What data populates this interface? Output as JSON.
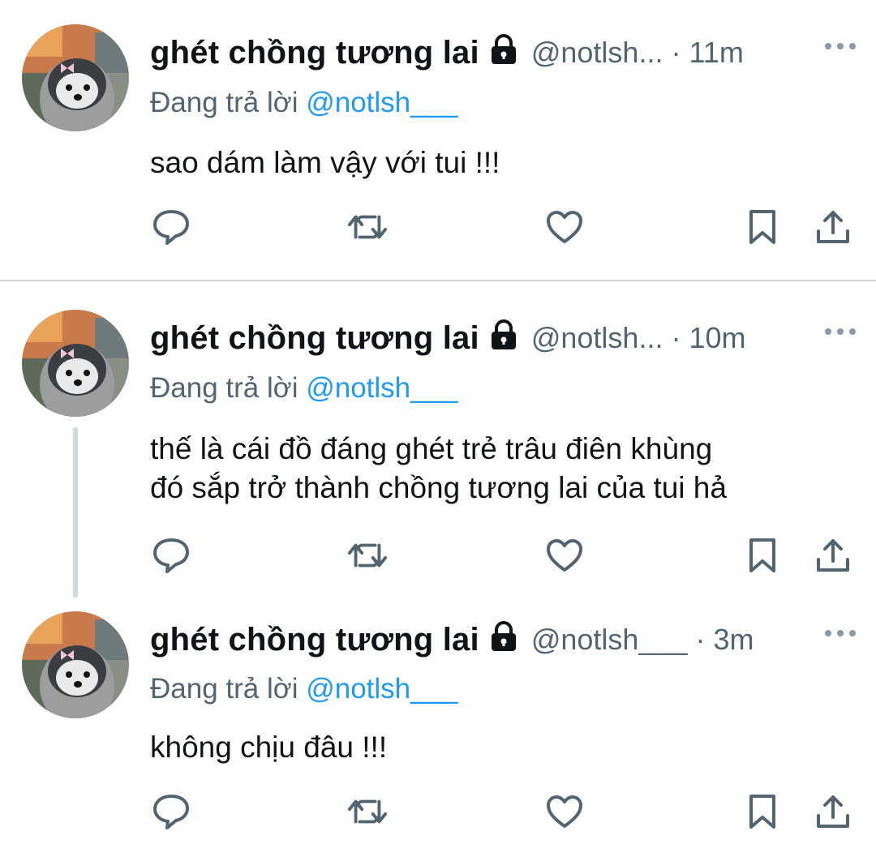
{
  "tweets": [
    {
      "display_name": "ghét chồng tương lai",
      "handle": "@notlsh...",
      "dot": "·",
      "time": "11m",
      "reply_prefix": "Đang trả lời ",
      "reply_mention": "@notlsh___",
      "text_lines": [
        "sao dám làm vậy với tui !!!"
      ]
    },
    {
      "display_name": "ghét chồng tương lai",
      "handle": "@notlsh...",
      "dot": "·",
      "time": "10m",
      "reply_prefix": "Đang trả lời ",
      "reply_mention": "@notlsh___",
      "text_lines": [
        "thế là cái đồ đáng ghét trẻ trâu điên khùng",
        "đó sắp trở thành chồng tương lai của tui hả"
      ]
    },
    {
      "display_name": "ghét chồng tương lai",
      "handle": "@notlsh___",
      "dot": "·",
      "time": "3m",
      "reply_prefix": "Đang trả lời ",
      "reply_mention": "@notlsh___",
      "text_lines": [
        "không chịu đâu !!!"
      ]
    }
  ],
  "icons": {
    "lock": "lock-icon",
    "more": "more-icon",
    "reply": "reply-icon",
    "retweet": "retweet-icon",
    "like": "heart-icon",
    "bookmark": "bookmark-icon",
    "share": "share-icon"
  },
  "colors": {
    "text": "#0f1419",
    "secondary": "#536471",
    "mention": "#1d9bf0",
    "divider": "#cfd9de"
  }
}
